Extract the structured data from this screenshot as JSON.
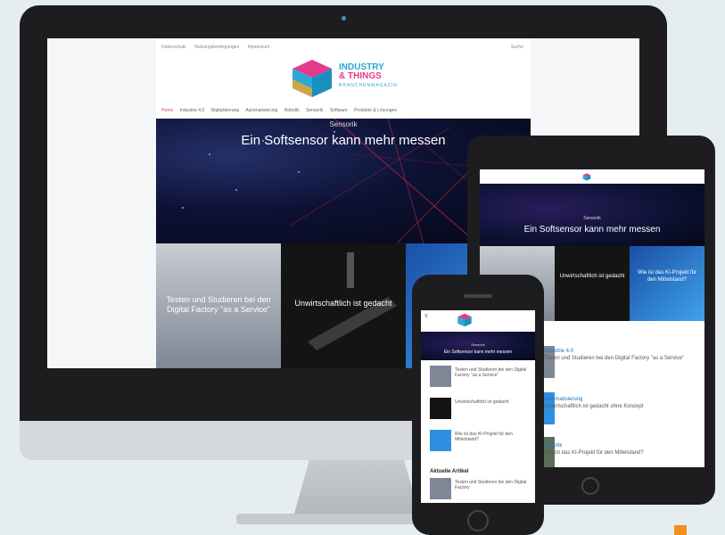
{
  "desktop": {
    "topnav": [
      "Datenschutz",
      "Nutzungsbedingungen",
      "Impressum"
    ],
    "topright": "Suche",
    "logo": {
      "line1": "INDUSTRY",
      "line2": "& THINGS",
      "line3": "BRANCHENMAGAZIN"
    },
    "mainnav": [
      "Home",
      "Industrie 4.0",
      "Digitalisierung",
      "Automatisierung",
      "Robotik",
      "Sensorik",
      "Software",
      "Produkte & Lösungen"
    ],
    "hero": {
      "label": "Sensorik",
      "title": "Ein Softsensor kann mehr messen"
    },
    "tiles": [
      {
        "text": "Testen und Studieren bei den Digital Factory \"as a Service\""
      },
      {
        "text": "Unwirtschaftlich ist gedacht"
      },
      {
        "text": ""
      }
    ]
  },
  "tablet": {
    "hero": {
      "label": "Sensorik",
      "title": "Ein Softsensor kann mehr messen"
    },
    "tiles": [
      "",
      "Unwirtschaftlich ist gedacht",
      "Wie ist das KI-Projekt für den Mittelstand?"
    ],
    "list": [
      {
        "cat": "Industrie 4.0",
        "text": "Testen und Studieren bei den Digital Factory \"as a Service\""
      },
      {
        "cat": "Automatisierung",
        "text": "Unwirtschaftlich ist gedacht ohne Konzept"
      },
      {
        "cat": "Robotik",
        "text": "Wie ist das KI-Projekt für den Mittelstand?"
      }
    ]
  },
  "phone": {
    "hero": {
      "label": "Sensorik",
      "title": "Ein Softsensor kann mehr messen"
    },
    "rows": [
      {
        "text": "Testen und Studieren bei den Digital Factory \"as a Service\""
      },
      {
        "text": "Unwirtschaftlich ist gedacht"
      },
      {
        "text": "Wie ist das KI-Projekt für den Mittelstand?"
      }
    ],
    "section": "Aktuelle Artikel",
    "last_row": "Testen und Studieren bei den Digital Factory"
  },
  "colors": {
    "accent_pink": "#e33b8c",
    "accent_blue": "#2aa8d8",
    "bezel": "#1d1d1f"
  }
}
